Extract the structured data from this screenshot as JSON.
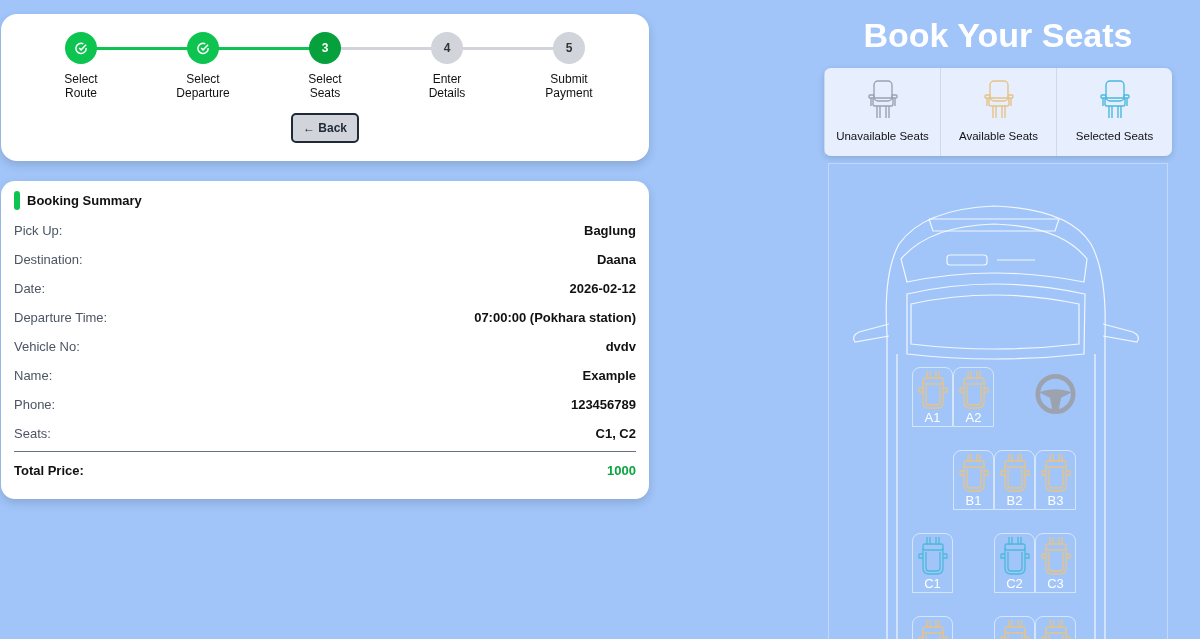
{
  "stepper": {
    "steps": [
      {
        "label": "Select Route",
        "completed": true,
        "selected": false
      },
      {
        "label": "Select Departure",
        "completed": true,
        "selected": false
      },
      {
        "label": "Select Seats",
        "number": "3",
        "completed": false,
        "selected": true
      },
      {
        "label": "Enter Details",
        "number": "4",
        "completed": false,
        "selected": false
      },
      {
        "label": "Submit Payment",
        "number": "5",
        "completed": false,
        "selected": false
      }
    ],
    "back_button": "← Back"
  },
  "summary": {
    "title": "Booking Summary",
    "rows": [
      {
        "label": "Pick Up:",
        "value": "Baglung"
      },
      {
        "label": "Destination:",
        "value": "Daana"
      },
      {
        "label": "Date:",
        "value": "2026-02-12"
      },
      {
        "label": "Departure Time:",
        "value": "07:00:00 (Pokhara station)"
      },
      {
        "label": "Vehicle No:",
        "value": "dvdv"
      },
      {
        "label": "Name:",
        "value": "Example"
      },
      {
        "label": "Phone:",
        "value": "123456789"
      },
      {
        "label": "Seats:",
        "value": "C1, C2"
      }
    ],
    "total": {
      "label": "Total Price:",
      "value": "1000"
    }
  },
  "title": "Book Your Seats",
  "legend": [
    {
      "label": "Unavailable Seats",
      "available": false,
      "selected": false
    },
    {
      "label": "Available Seats",
      "available": true,
      "selected": false
    },
    {
      "label": "Selected Seats",
      "selected": true
    }
  ],
  "seat_rows": [
    [
      {
        "kind": "seat",
        "label": "A1",
        "available": true,
        "selected": false
      },
      {
        "kind": "seat",
        "label": "A2",
        "available": true,
        "selected": false
      },
      {
        "kind": "gap"
      },
      {
        "kind": "driver"
      }
    ],
    [
      {
        "kind": "gap"
      },
      {
        "kind": "seat",
        "label": "B1",
        "available": true,
        "selected": false
      },
      {
        "kind": "seat",
        "label": "B2",
        "available": true,
        "selected": false
      },
      {
        "kind": "seat",
        "label": "B3",
        "available": true,
        "selected": false
      }
    ],
    [
      {
        "kind": "seat",
        "label": "C1",
        "selected": true
      },
      {
        "kind": "gap"
      },
      {
        "kind": "seat",
        "label": "C2",
        "selected": true
      },
      {
        "kind": "seat",
        "label": "C3",
        "available": true,
        "selected": false
      }
    ],
    [
      {
        "kind": "seat",
        "available": true,
        "selected": false
      },
      {
        "kind": "gap"
      },
      {
        "kind": "seat",
        "available": true,
        "selected": false
      },
      {
        "kind": "seat",
        "available": true,
        "selected": false
      }
    ]
  ]
}
